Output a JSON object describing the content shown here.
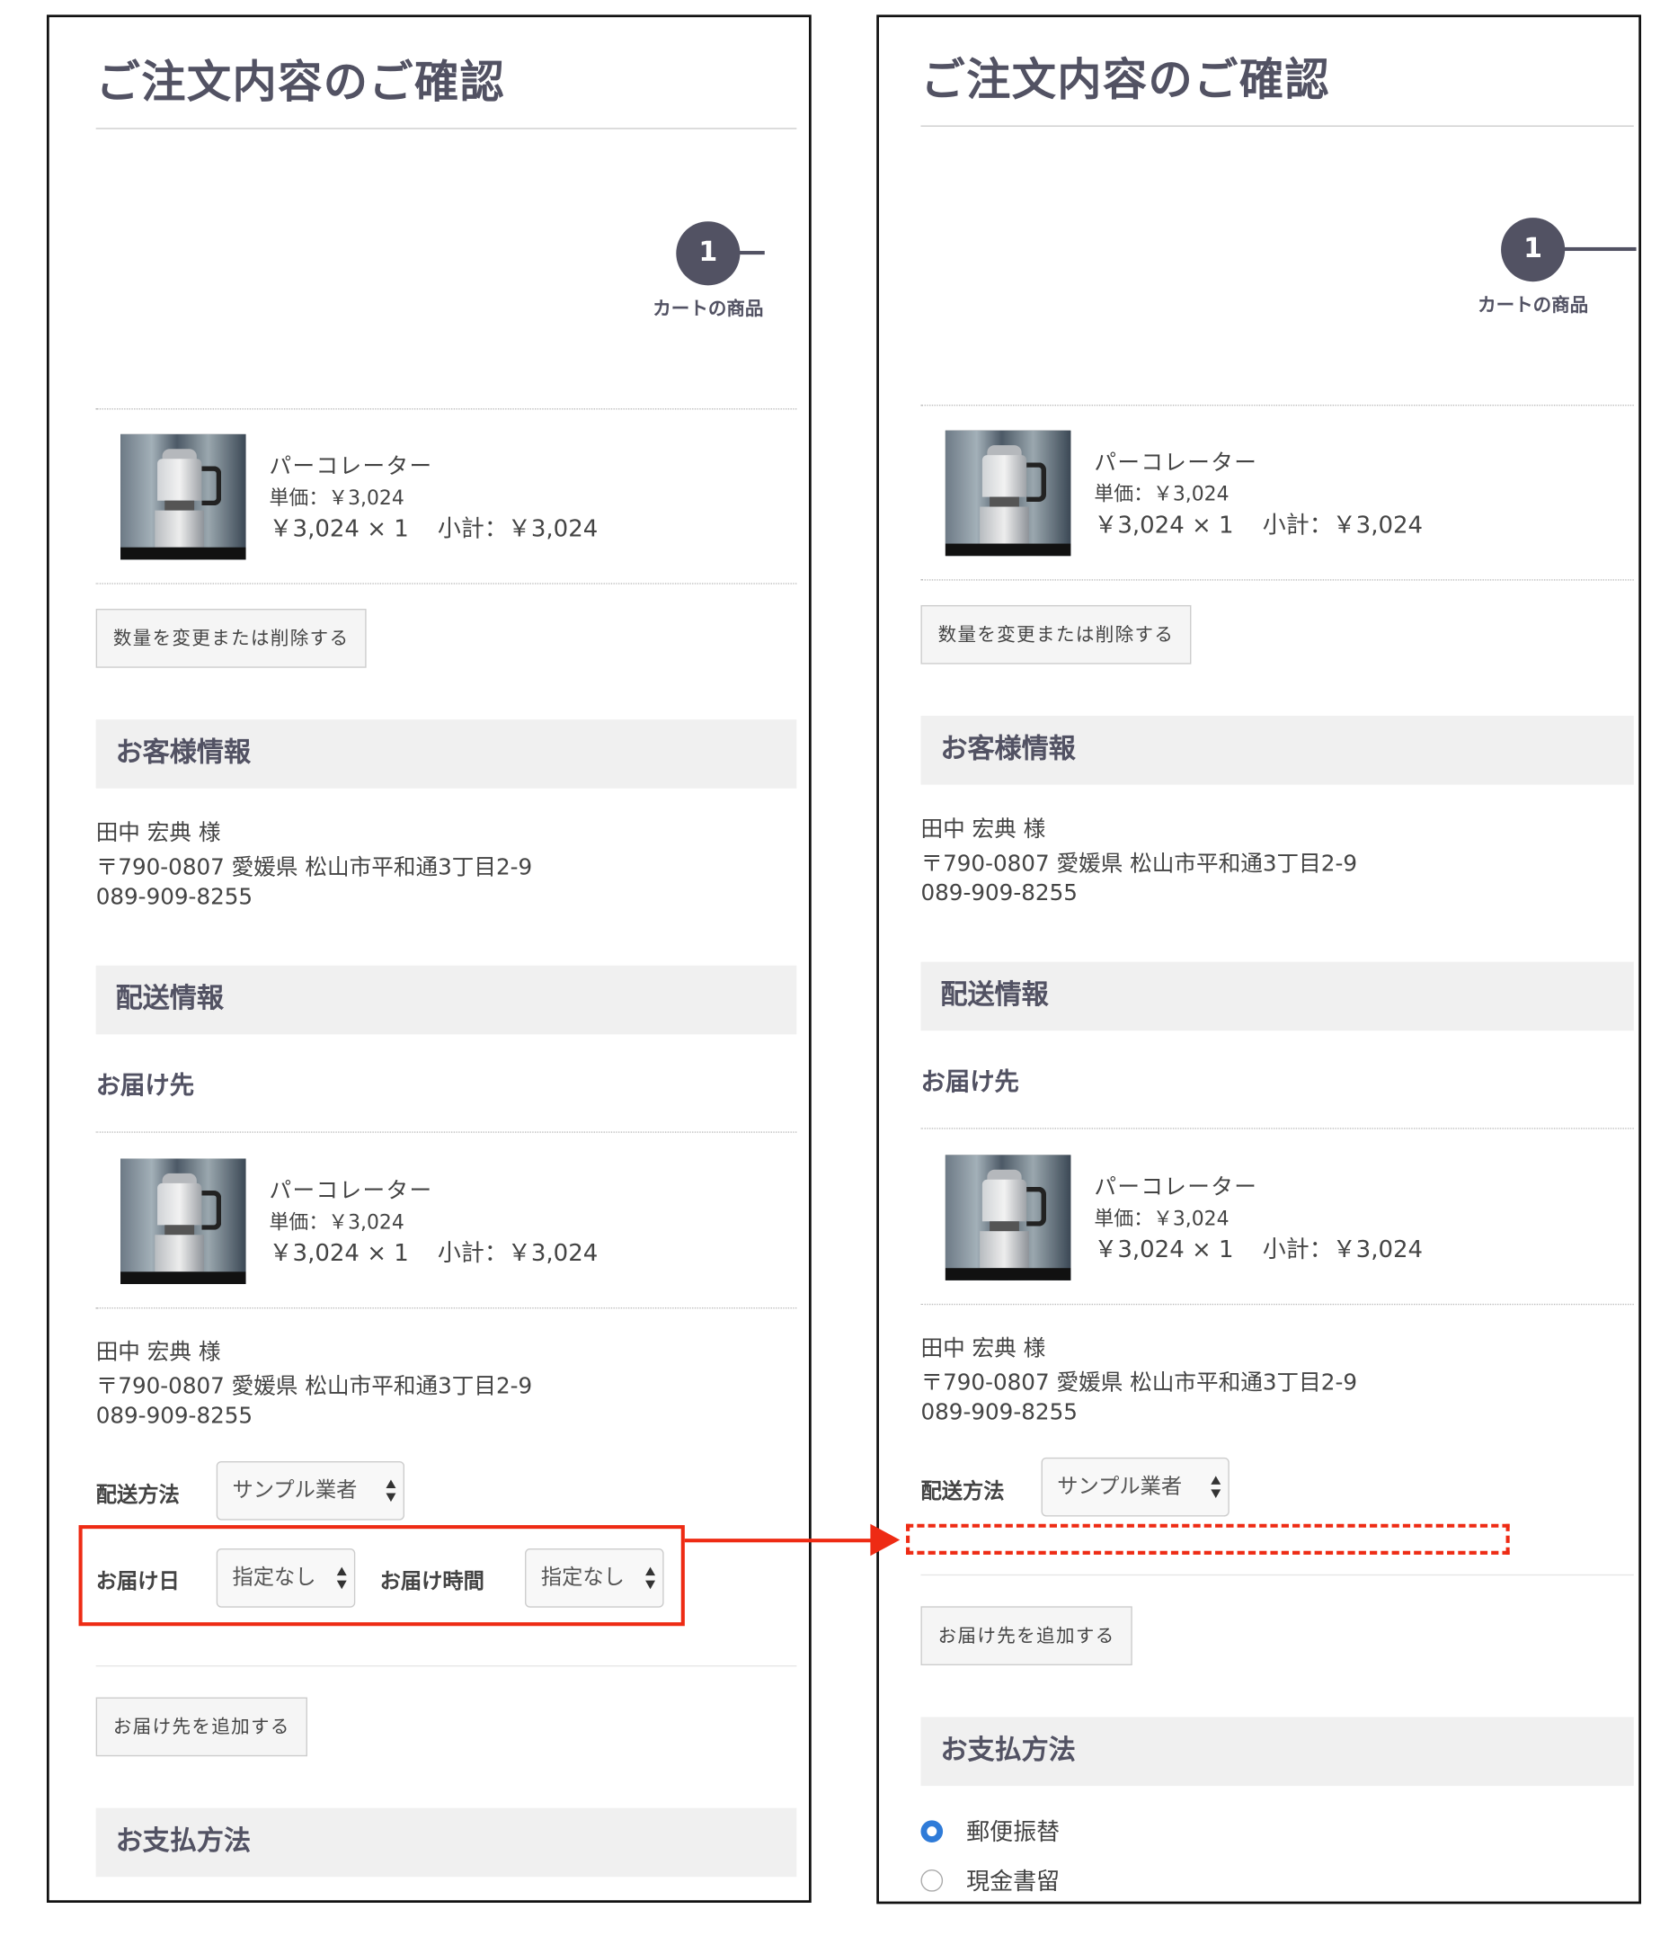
{
  "page": {
    "title": "ご注文内容のご確認"
  },
  "step": {
    "number": "1",
    "label": "カートの商品"
  },
  "cart_item": {
    "name": "パーコレーター",
    "unit_price": "単価：￥3,024",
    "price_qty": "￥3,024 × 1",
    "subtotal": "小計：￥3,024"
  },
  "buttons": {
    "change_quantity": "数量を変更または削除する",
    "add_destination": "お届け先を追加する"
  },
  "customer": {
    "heading": "お客様情報",
    "name": "田中 宏典 様",
    "address": "〒790-0807 愛媛県 松山市平和通3丁目2-9",
    "phone": "089-909-8255"
  },
  "shipping": {
    "heading": "配送情報",
    "destination_heading": "お届け先",
    "method_label": "配送方法",
    "method_value": "サンプル業者",
    "date_label": "お届け日",
    "date_value": "指定なし",
    "time_label": "お届け時間",
    "time_value": "指定なし"
  },
  "payment": {
    "heading": "お支払方法",
    "options": [
      {
        "label": "郵便振替",
        "selected": true
      },
      {
        "label": "現金書留",
        "selected": false
      }
    ]
  },
  "annotation": {
    "highlight_color": "#ee2b14"
  }
}
